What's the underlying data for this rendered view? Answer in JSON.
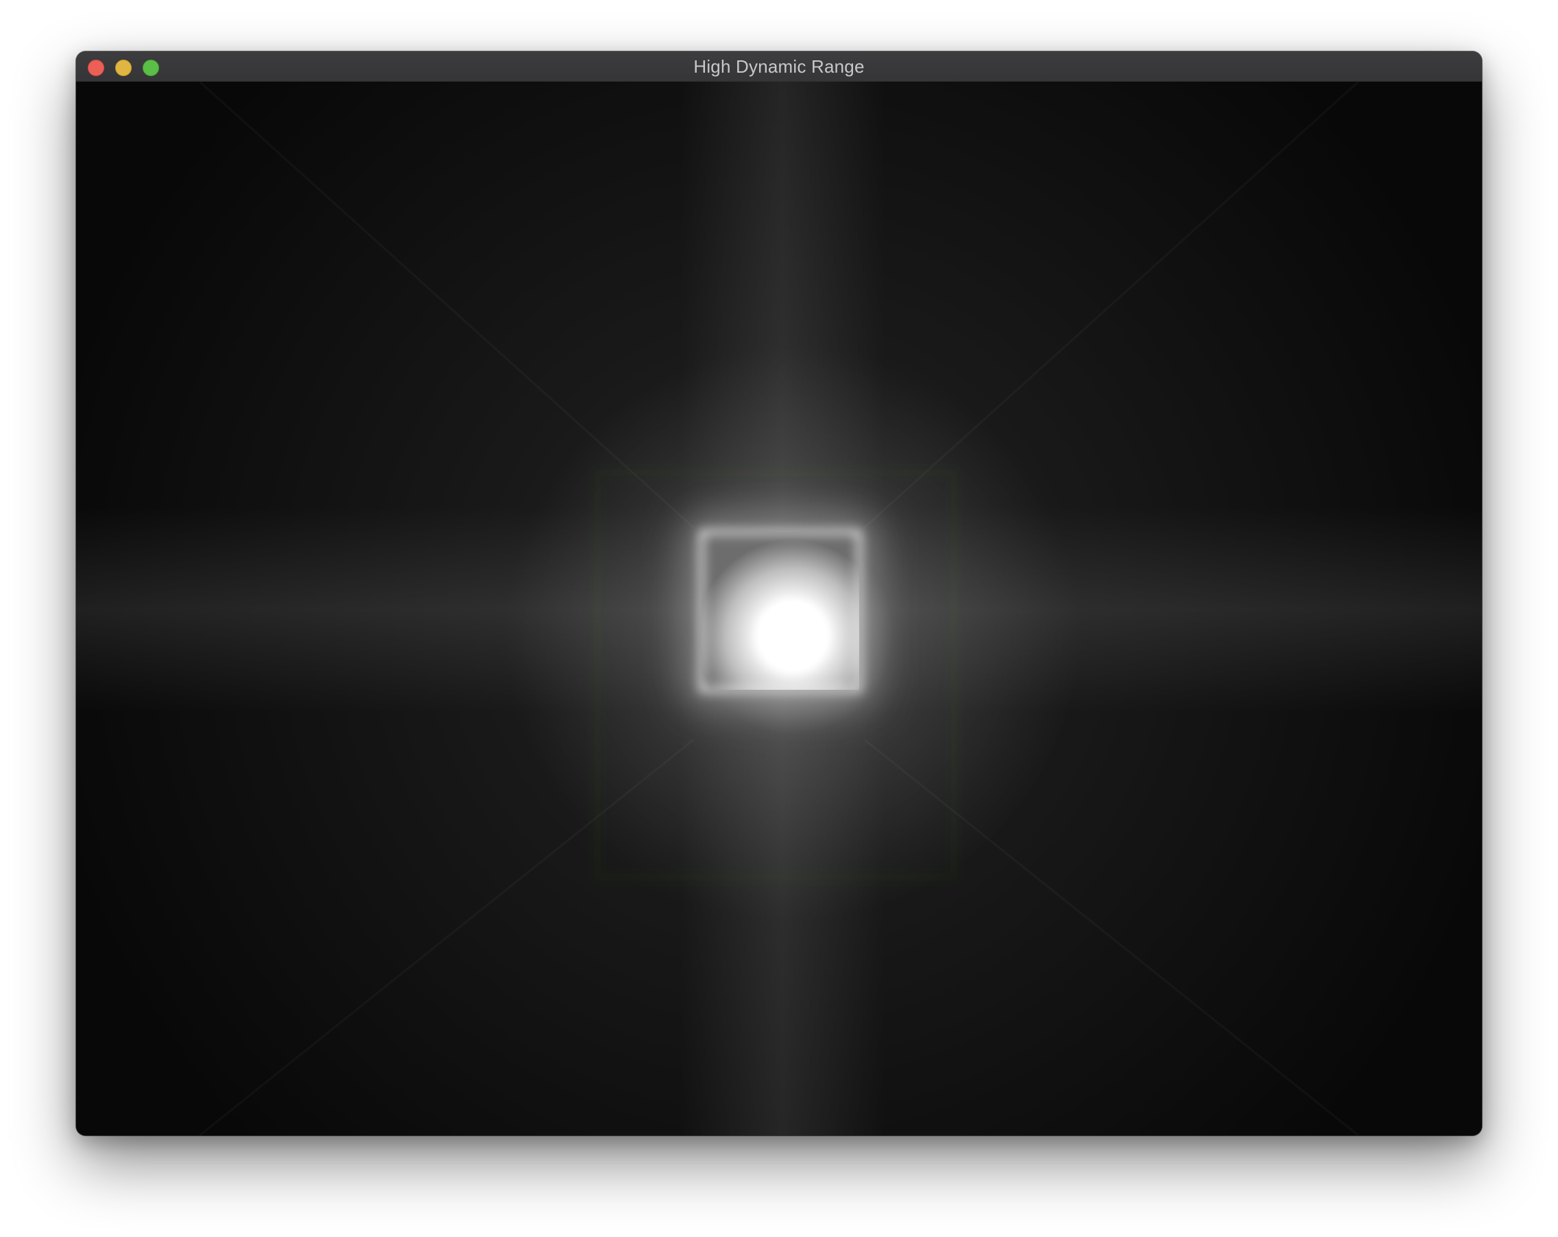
{
  "window": {
    "title": "High Dynamic Range",
    "controls": {
      "close_icon": "close-icon",
      "minimize_icon": "minimize-icon",
      "zoom_icon": "zoom-icon"
    }
  },
  "scene": {
    "description_colors": {
      "background": "#0a0a0a",
      "light_core": "#ffffff",
      "square_frame": "#ffffff"
    }
  }
}
